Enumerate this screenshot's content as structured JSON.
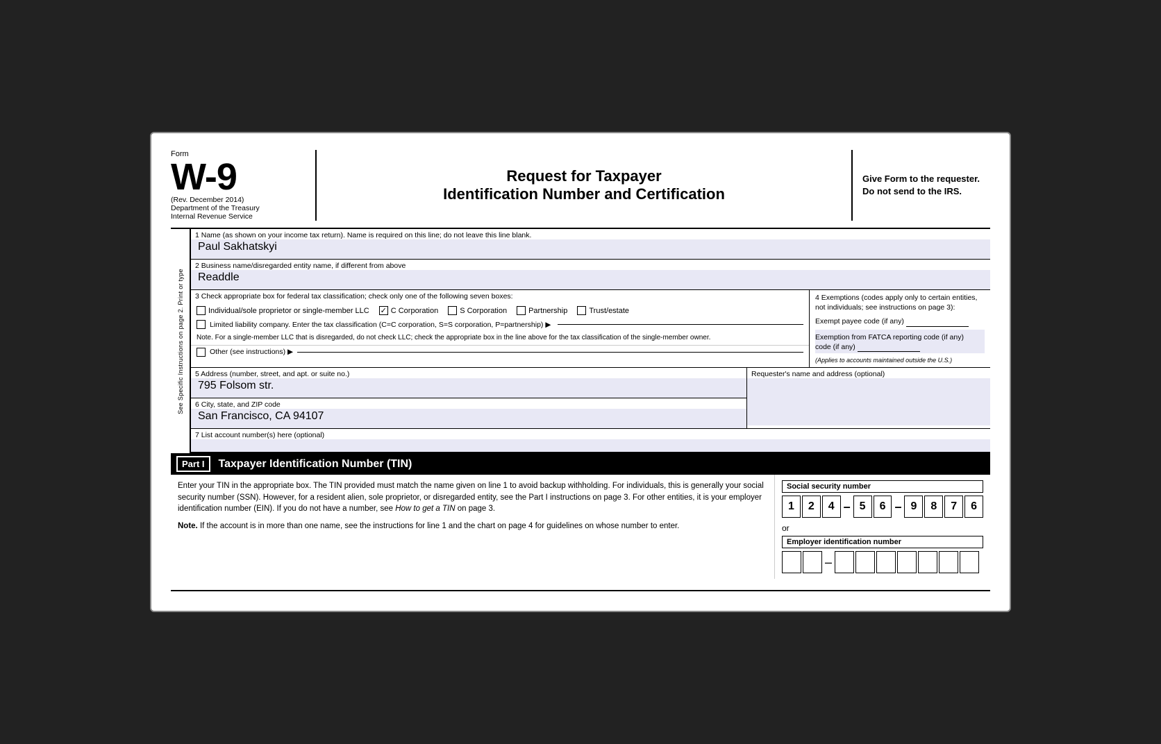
{
  "header": {
    "form_label": "Form",
    "form_number": "W-9",
    "revision": "(Rev. December 2014)",
    "dept1": "Department of the Treasury",
    "dept2": "Internal Revenue Service",
    "title_line1": "Request for Taxpayer",
    "title_line2": "Identification Number and Certification",
    "instructions": "Give Form to the requester. Do not send to the IRS."
  },
  "sidebar": {
    "text": "See Specific Instructions on page 2.     Print or type"
  },
  "fields": {
    "field1_label": "1  Name (as shown on your income tax return). Name is required on this line; do not leave this line blank.",
    "field1_value": "Paul Sakhatskyi",
    "field2_label": "2  Business name/disregarded entity name, if different from above",
    "field2_value": "Readdle",
    "field3_label": "3  Check appropriate box for federal tax classification; check only one of the following seven boxes:",
    "checkbox_individual": "Individual/sole proprietor or single-member LLC",
    "checkbox_c_corp": "C Corporation",
    "checkbox_s_corp": "S Corporation",
    "checkbox_partnership": "Partnership",
    "checkbox_trust": "Trust/estate",
    "checkbox_llc_label": "Limited liability company. Enter the tax classification (C=C corporation, S=S corporation, P=partnership) ▶",
    "note_text": "Note. For a single-member LLC that is disregarded, do not check LLC; check the appropriate box in the line above for the tax classification of the single-member owner.",
    "other_label": "Other (see instructions) ▶",
    "field4_label": "4  Exemptions (codes apply only to certain entities, not individuals; see instructions on page 3):",
    "exempt_payee_label": "Exempt payee code (if any)",
    "fatca_label": "Exemption from FATCA reporting code (if any)",
    "fatca_applies": "(Applies to accounts maintained outside the U.S.)",
    "field5_label": "5  Address (number, street, and apt. or suite no.)",
    "field5_value": "795 Folsom str.",
    "requester_label": "Requester's name and address (optional)",
    "field6_label": "6  City, state, and ZIP code",
    "field6_value": "San Francisco, CA 94107",
    "field7_label": "7  List account number(s) here (optional)"
  },
  "part1": {
    "label": "Part I",
    "title": "Taxpayer Identification Number (TIN)",
    "body_text": "Enter your TIN in the appropriate box. The TIN provided must match the name given on line 1 to avoid backup withholding. For individuals, this is generally your social security number (SSN). However, for a resident alien, sole proprietor, or disregarded entity, see the Part I instructions on page 3. For other entities, it is your employer identification number (EIN). If you do not have a number, see How to get a TIN on page 3.",
    "note_text": "Note. If the account is in more than one name, see the instructions for line 1 and the chart on page 4 for guidelines on whose number to enter.",
    "ssn_label": "Social security number",
    "ssn_digits": [
      "1",
      "2",
      "4",
      "",
      "5",
      "6",
      "",
      "9",
      "8",
      "7",
      "6"
    ],
    "or_label": "or",
    "ein_label": "Employer identification number",
    "ein_digits": [
      "",
      "",
      "",
      "",
      "",
      "",
      "",
      "",
      ""
    ]
  }
}
